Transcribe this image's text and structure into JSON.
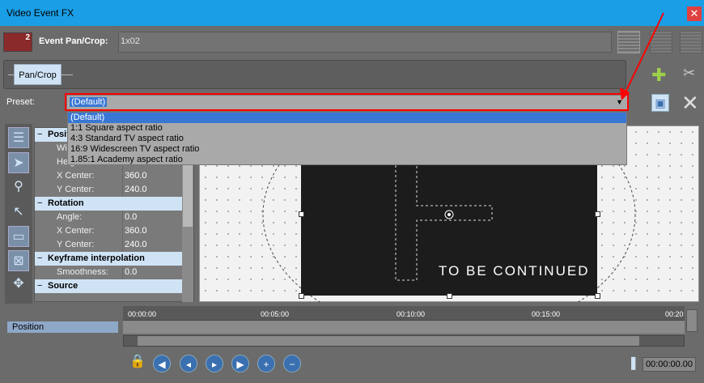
{
  "window": {
    "title": "Video Event FX",
    "close_glyph": "✕"
  },
  "event": {
    "label": "Event Pan/Crop:",
    "value": "1x02",
    "badge": "2"
  },
  "chain": {
    "plugin_label": "Pan/Crop"
  },
  "preset": {
    "label": "Preset:",
    "selected": "(Default)",
    "options": [
      "(Default)",
      "1:1 Square aspect ratio",
      "4:3 Standard TV aspect ratio",
      "16:9 Widescreen TV aspect ratio",
      "1.85:1 Academy aspect ratio"
    ]
  },
  "props": {
    "sections": [
      {
        "title": "Posit",
        "rows": [
          {
            "k": "Wid",
            "v": ""
          },
          {
            "k": "Height:",
            "v": ""
          },
          {
            "k": "X Center:",
            "v": "360.0"
          },
          {
            "k": "Y Center:",
            "v": "240.0"
          }
        ]
      },
      {
        "title": "Rotation",
        "rows": [
          {
            "k": "Angle:",
            "v": "0.0"
          },
          {
            "k": "X Center:",
            "v": "360.0"
          },
          {
            "k": "Y Center:",
            "v": "240.0"
          }
        ]
      },
      {
        "title": "Keyframe interpolation",
        "rows": [
          {
            "k": "Smoothness:",
            "v": "0.0"
          }
        ]
      },
      {
        "title": "Source",
        "rows": []
      }
    ]
  },
  "preview": {
    "caption": "TO BE CONTINUED"
  },
  "timeline": {
    "ticks": [
      "00:00:00",
      "00:05:00",
      "00:10:00",
      "00:15:00",
      "00:20"
    ],
    "track_label": "Position",
    "timecode": "00:00:00.00"
  },
  "colors": {
    "titlebar": "#1a9ee5",
    "highlight": "#3877d4",
    "accent_red": "#ff0000"
  }
}
